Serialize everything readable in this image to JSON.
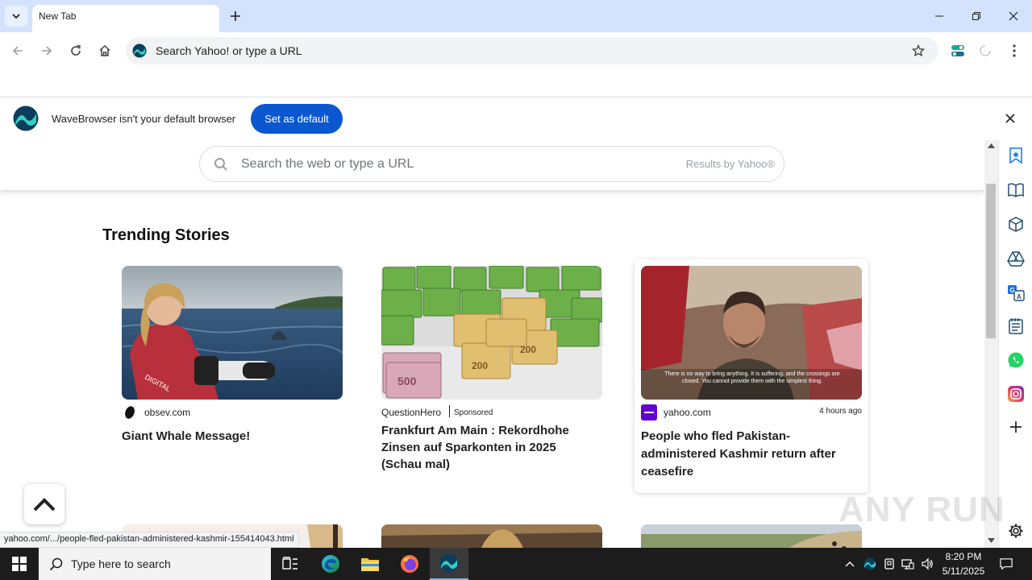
{
  "browser": {
    "tab_title": "New Tab",
    "omnibox_placeholder": "Search Yahoo! or type a URL"
  },
  "infobar": {
    "message": "WaveBrowser isn't your default browser",
    "button_label": "Set as default"
  },
  "search": {
    "placeholder": "Search the web or type a URL",
    "results_by": "Results by Yahoo®"
  },
  "trending": {
    "title": "Trending Stories",
    "cards": [
      {
        "source": "obsev.com",
        "sponsored": "",
        "time": "",
        "title": "Giant Whale Message!"
      },
      {
        "source": "QuestionHero",
        "sponsored": "Sponsored",
        "time": "",
        "title": "Frankfurt Am Main : Rekordhohe Zinsen auf Sparkonten in 2025 (Schau mal)"
      },
      {
        "source": "yahoo.com",
        "sponsored": "",
        "time": "4 hours ago",
        "title": "People who fled Pakistan-administered Kashmir return after ceasefire"
      }
    ],
    "image_caption": "There is no way to bring anything. It is suffering, and the crossings are closed. You cannot provide them with the simplest thing."
  },
  "status_url": "yahoo.com/.../people-fled-pakistan-administered-kashmir-155414043.html",
  "watermark": "ANY RUN",
  "taskbar": {
    "search_placeholder": "Type here to search",
    "time": "8:20 PM",
    "date": "5/11/2025"
  },
  "colors": {
    "tab_strip": "#d3e3fd",
    "accent_button": "#0b57d0",
    "taskbar": "#1c1c1c"
  }
}
